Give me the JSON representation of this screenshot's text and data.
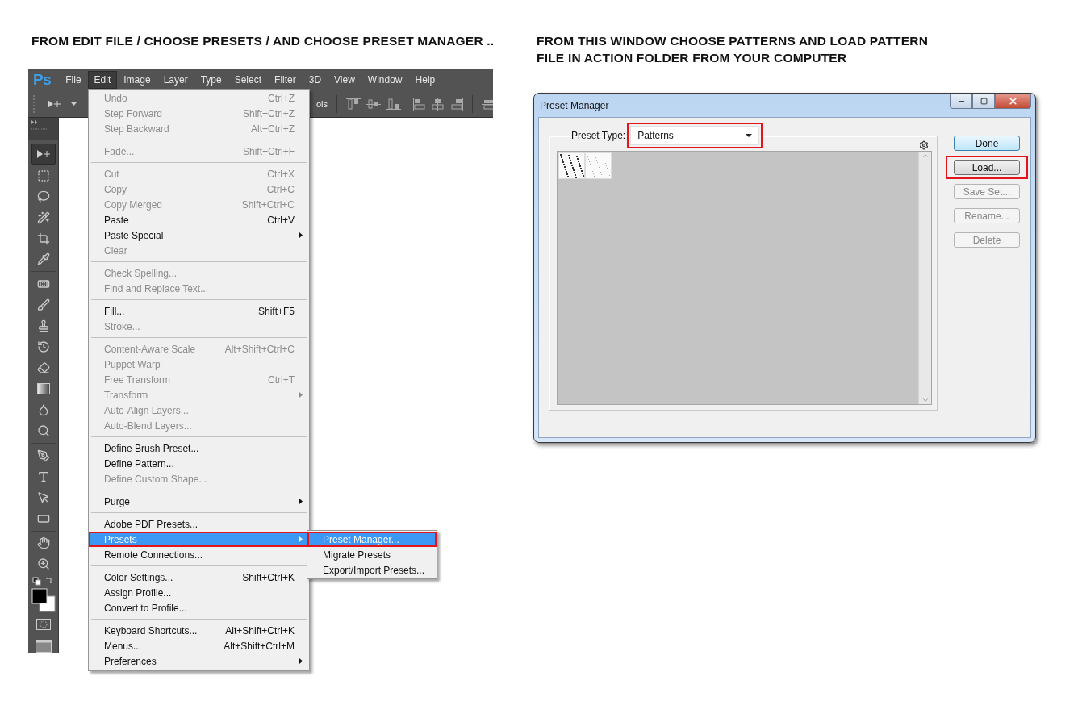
{
  "instructions": [
    {
      "text": "FROM EDIT FILE / CHOOSE PRESETS / AND CHOOSE PRESET MANAGER .."
    },
    {
      "text": "FROM THIS WINDOW CHOOSE PATTERNS AND LOAD PATTERN FILE IN ACTION FOLDER FROM YOUR COMPUTER"
    }
  ],
  "photoshop": {
    "logo": "Ps",
    "menu_bar": [
      {
        "label": "File",
        "selected": false
      },
      {
        "label": "Edit",
        "selected": true
      },
      {
        "label": "Image",
        "selected": false
      },
      {
        "label": "Layer",
        "selected": false
      },
      {
        "label": "Type",
        "selected": false
      },
      {
        "label": "Select",
        "selected": false
      },
      {
        "label": "Filter",
        "selected": false
      },
      {
        "label": "3D",
        "selected": false
      },
      {
        "label": "View",
        "selected": false
      },
      {
        "label": "Window",
        "selected": false
      },
      {
        "label": "Help",
        "selected": false
      }
    ],
    "options_bar": {
      "partial_text": "ols"
    },
    "edit_menu": [
      {
        "kind": "item",
        "label": "Undo",
        "shortcut": "Ctrl+Z",
        "disabled": true,
        "submenu": false,
        "selected": false,
        "callout": false
      },
      {
        "kind": "item",
        "label": "Step Forward",
        "shortcut": "Shift+Ctrl+Z",
        "disabled": true,
        "submenu": false,
        "selected": false,
        "callout": false
      },
      {
        "kind": "item",
        "label": "Step Backward",
        "shortcut": "Alt+Ctrl+Z",
        "disabled": true,
        "submenu": false,
        "selected": false,
        "callout": false
      },
      {
        "kind": "separator"
      },
      {
        "kind": "item",
        "label": "Fade...",
        "shortcut": "Shift+Ctrl+F",
        "disabled": true,
        "submenu": false,
        "selected": false,
        "callout": false
      },
      {
        "kind": "separator"
      },
      {
        "kind": "item",
        "label": "Cut",
        "shortcut": "Ctrl+X",
        "disabled": true,
        "submenu": false,
        "selected": false,
        "callout": false
      },
      {
        "kind": "item",
        "label": "Copy",
        "shortcut": "Ctrl+C",
        "disabled": true,
        "submenu": false,
        "selected": false,
        "callout": false
      },
      {
        "kind": "item",
        "label": "Copy Merged",
        "shortcut": "Shift+Ctrl+C",
        "disabled": true,
        "submenu": false,
        "selected": false,
        "callout": false
      },
      {
        "kind": "item",
        "label": "Paste",
        "shortcut": "Ctrl+V",
        "disabled": false,
        "submenu": false,
        "selected": false,
        "callout": false
      },
      {
        "kind": "item",
        "label": "Paste Special",
        "disabled": false,
        "submenu": true,
        "selected": false,
        "callout": false
      },
      {
        "kind": "item",
        "label": "Clear",
        "disabled": true,
        "submenu": false,
        "selected": false,
        "callout": false
      },
      {
        "kind": "separator"
      },
      {
        "kind": "item",
        "label": "Check Spelling...",
        "disabled": true,
        "submenu": false,
        "selected": false,
        "callout": false
      },
      {
        "kind": "item",
        "label": "Find and Replace Text...",
        "disabled": true,
        "submenu": false,
        "selected": false,
        "callout": false
      },
      {
        "kind": "separator"
      },
      {
        "kind": "item",
        "label": "Fill...",
        "shortcut": "Shift+F5",
        "disabled": false,
        "submenu": false,
        "selected": false,
        "callout": false
      },
      {
        "kind": "item",
        "label": "Stroke...",
        "disabled": true,
        "submenu": false,
        "selected": false,
        "callout": false
      },
      {
        "kind": "separator"
      },
      {
        "kind": "item",
        "label": "Content-Aware Scale",
        "shortcut": "Alt+Shift+Ctrl+C",
        "disabled": true,
        "submenu": false,
        "selected": false,
        "callout": false
      },
      {
        "kind": "item",
        "label": "Puppet Warp",
        "disabled": true,
        "submenu": false,
        "selected": false,
        "callout": false
      },
      {
        "kind": "item",
        "label": "Free Transform",
        "shortcut": "Ctrl+T",
        "disabled": true,
        "submenu": false,
        "selected": false,
        "callout": false
      },
      {
        "kind": "item",
        "label": "Transform",
        "disabled": true,
        "submenu": true,
        "selected": false,
        "callout": false
      },
      {
        "kind": "item",
        "label": "Auto-Align Layers...",
        "disabled": true,
        "submenu": false,
        "selected": false,
        "callout": false
      },
      {
        "kind": "item",
        "label": "Auto-Blend Layers...",
        "disabled": true,
        "submenu": false,
        "selected": false,
        "callout": false
      },
      {
        "kind": "separator"
      },
      {
        "kind": "item",
        "label": "Define Brush Preset...",
        "disabled": false,
        "submenu": false,
        "selected": false,
        "callout": false
      },
      {
        "kind": "item",
        "label": "Define Pattern...",
        "disabled": false,
        "submenu": false,
        "selected": false,
        "callout": false
      },
      {
        "kind": "item",
        "label": "Define Custom Shape...",
        "disabled": true,
        "submenu": false,
        "selected": false,
        "callout": false
      },
      {
        "kind": "separator"
      },
      {
        "kind": "item",
        "label": "Purge",
        "disabled": false,
        "submenu": true,
        "selected": false,
        "callout": false
      },
      {
        "kind": "separator"
      },
      {
        "kind": "item",
        "label": "Adobe PDF Presets...",
        "disabled": false,
        "submenu": false,
        "selected": false,
        "callout": false
      },
      {
        "kind": "item",
        "label": "Presets",
        "disabled": false,
        "submenu": true,
        "selected": true,
        "callout": true
      },
      {
        "kind": "item",
        "label": "Remote Connections...",
        "disabled": false,
        "submenu": false,
        "selected": false,
        "callout": false
      },
      {
        "kind": "separator"
      },
      {
        "kind": "item",
        "label": "Color Settings...",
        "shortcut": "Shift+Ctrl+K",
        "disabled": false,
        "submenu": false,
        "selected": false,
        "callout": false
      },
      {
        "kind": "item",
        "label": "Assign Profile...",
        "disabled": false,
        "submenu": false,
        "selected": false,
        "callout": false
      },
      {
        "kind": "item",
        "label": "Convert to Profile...",
        "disabled": false,
        "submenu": false,
        "selected": false,
        "callout": false
      },
      {
        "kind": "separator"
      },
      {
        "kind": "item",
        "label": "Keyboard Shortcuts...",
        "shortcut": "Alt+Shift+Ctrl+K",
        "disabled": false,
        "submenu": false,
        "selected": false,
        "callout": false
      },
      {
        "kind": "item",
        "label": "Menus...",
        "shortcut": "Alt+Shift+Ctrl+M",
        "disabled": false,
        "submenu": false,
        "selected": false,
        "callout": false
      },
      {
        "kind": "item",
        "label": "Preferences",
        "disabled": false,
        "submenu": true,
        "selected": false,
        "callout": false
      }
    ],
    "presets_submenu": [
      {
        "label": "Preset Manager...",
        "selected": true,
        "callout": true
      },
      {
        "label": "Migrate Presets",
        "selected": false,
        "callout": false
      },
      {
        "label": "Export/Import Presets...",
        "selected": false,
        "callout": false
      }
    ]
  },
  "dialog": {
    "title": "Preset Manager",
    "preset_type_label": "Preset Type:",
    "preset_type": {
      "value": "Patterns",
      "callout": true
    },
    "buttons": [
      {
        "label": "Done",
        "kind": "default",
        "disabled": false,
        "callout": false
      },
      {
        "label": "Load...",
        "kind": "normal",
        "disabled": false,
        "callout": true
      },
      {
        "label": "Save Set...",
        "kind": "normal",
        "disabled": true,
        "callout": false
      },
      {
        "label": "Rename...",
        "kind": "normal",
        "disabled": true,
        "callout": false
      },
      {
        "label": "Delete",
        "kind": "normal",
        "disabled": true,
        "callout": false
      }
    ]
  }
}
